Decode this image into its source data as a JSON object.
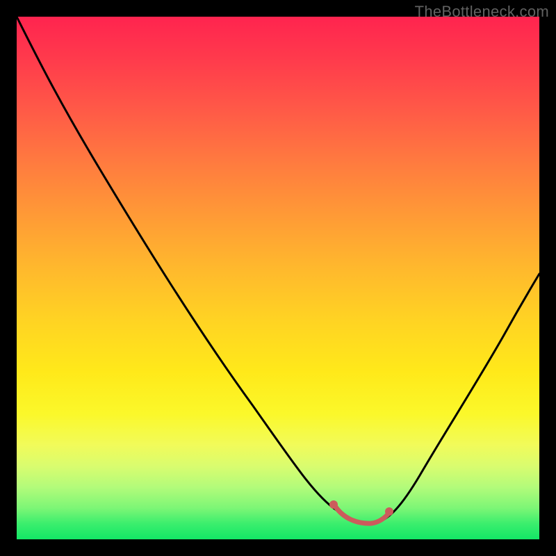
{
  "watermark": "TheBottleneck.com",
  "colors": {
    "background": "#000000",
    "gradient_top": "#ff244f",
    "gradient_bottom": "#13e766",
    "curve": "#000000",
    "highlight": "#cc5c5c",
    "watermark_text": "#616161"
  },
  "chart_data": {
    "type": "line",
    "title": "",
    "xlabel": "",
    "ylabel": "",
    "xlim": [
      0,
      100
    ],
    "ylim": [
      0,
      100
    ],
    "x": [
      0,
      5,
      10,
      15,
      20,
      25,
      30,
      35,
      40,
      45,
      50,
      55,
      58,
      60,
      63,
      66,
      68,
      70,
      75,
      80,
      85,
      90,
      95,
      100
    ],
    "values": [
      100,
      93,
      85,
      77,
      69,
      61,
      53,
      45,
      37,
      29,
      21,
      14,
      10,
      8,
      6,
      5,
      5,
      6,
      9,
      14,
      21,
      30,
      41,
      53
    ],
    "trough_segment": {
      "x_start": 60,
      "x_end": 70,
      "y": 5
    },
    "highlight_points": [
      {
        "x": 60,
        "y": 8
      },
      {
        "x": 70,
        "y": 7
      }
    ]
  }
}
